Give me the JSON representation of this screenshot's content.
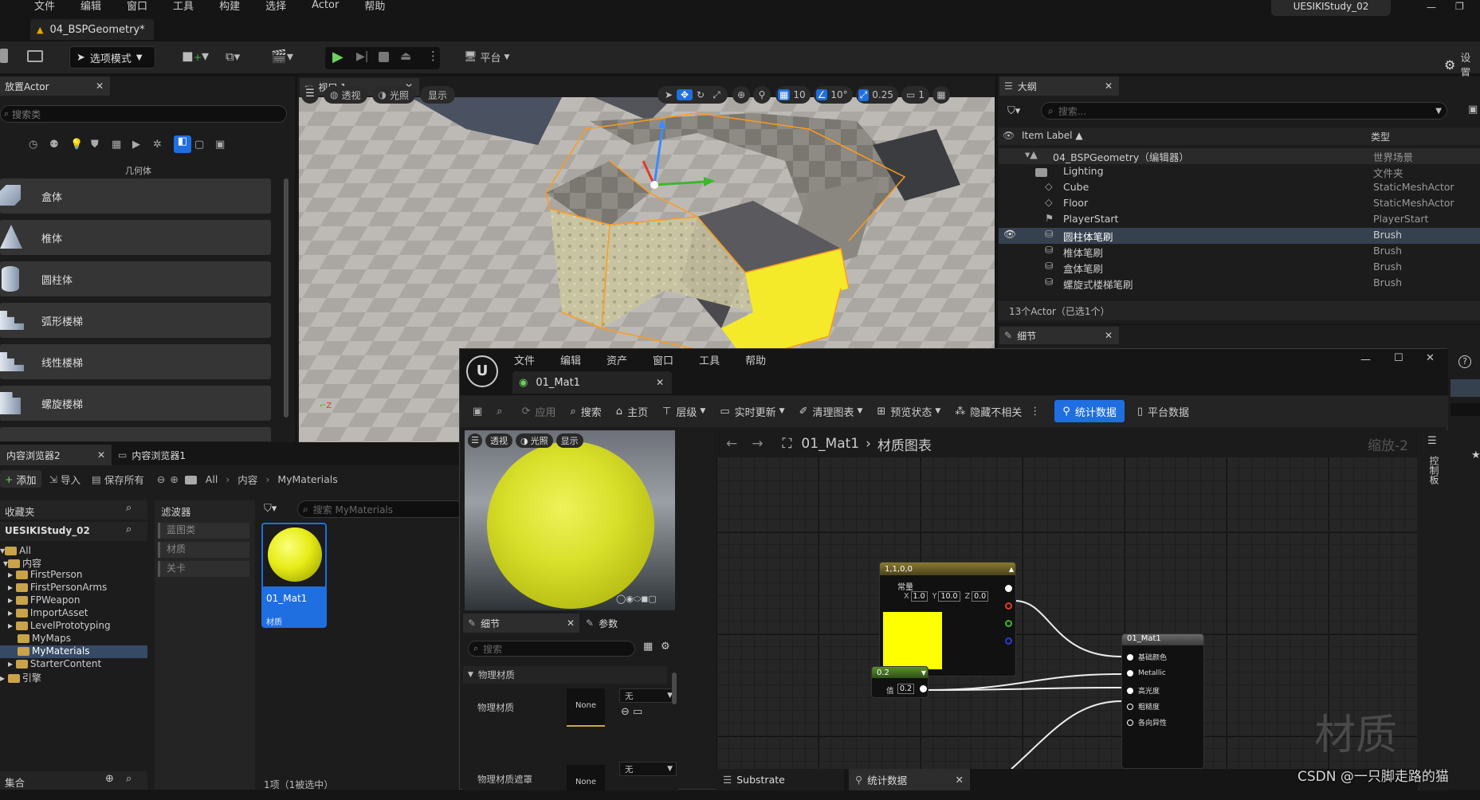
{
  "menu_bar": {
    "items": [
      "文件",
      "编辑",
      "窗口",
      "工具",
      "构建",
      "选择",
      "Actor",
      "帮助"
    ],
    "project_name": "UESIKIStudy_02"
  },
  "level_tab": {
    "label": "04_BSPGeometry*"
  },
  "main_toolbar": {
    "mode_label": "选项模式",
    "platform_label": "平台",
    "settings_label": "设置"
  },
  "place_actors": {
    "tab_label": "放置Actor",
    "search_placeholder": "搜索类",
    "category_label": "几何体",
    "items": [
      "盒体",
      "椎体",
      "圆柱体",
      "弧形楼梯",
      "线性楼梯",
      "螺旋楼梯"
    ]
  },
  "viewport": {
    "tab_label": "视口 1",
    "buttons": [
      "透视",
      "光照",
      "显示"
    ],
    "grid_snap": "10",
    "rotation_snap": "10°",
    "scale_snap": "0.25",
    "camera_speed": "1",
    "highlight_color": "#f4ea2a"
  },
  "outliner": {
    "tab_label": "大纲",
    "search_placeholder": "搜索...",
    "col_label": "Item Label ▲",
    "col_type": "类型",
    "rows": [
      {
        "name": "04_BSPGeometry（编辑器）",
        "type": "世界场景"
      },
      {
        "name": "Lighting",
        "type": "文件夹"
      },
      {
        "name": "Cube",
        "type": "StaticMeshActor"
      },
      {
        "name": "Floor",
        "type": "StaticMeshActor"
      },
      {
        "name": "PlayerStart",
        "type": "PlayerStart"
      },
      {
        "name": "圆柱体笔刷",
        "type": "Brush"
      },
      {
        "name": "椎体笔刷",
        "type": "Brush"
      },
      {
        "name": "盒体笔刷",
        "type": "Brush"
      },
      {
        "name": "螺旋式楼梯笔刷",
        "type": "Brush"
      }
    ],
    "footer": "13个Actor（已选1个）"
  },
  "details_tab": {
    "label": "细节"
  },
  "content_browser": {
    "tab1": "内容浏览器2",
    "tab2": "内容浏览器1",
    "add_label": "添加",
    "import_label": "导入",
    "save_all_label": "保存所有",
    "path": [
      "All",
      "内容",
      "MyMaterials"
    ],
    "favorites_label": "收藏夹",
    "project_label": "UESIKIStudy_02",
    "filters_label": "滤波器",
    "filters": [
      "蓝图类",
      "材质",
      "关卡"
    ],
    "search_placeholder": "搜索 MyMaterials",
    "tree": [
      "All",
      "内容",
      "FirstPerson",
      "FirstPersonArms",
      "FPWeapon",
      "ImportAsset",
      "LevelPrototyping",
      "MyMaps",
      "MyMaterials",
      "StarterContent",
      "引擎"
    ],
    "asset_name": "01_Mat1",
    "asset_type": "材质",
    "collections_label": "集合",
    "status": "1项（1被选中）"
  },
  "material_editor": {
    "menu": [
      "文件",
      "编辑",
      "资产",
      "窗口",
      "工具",
      "帮助"
    ],
    "tab_label": "01_Mat1",
    "toolbar": [
      "应用",
      "搜索",
      "主页",
      "层级",
      "实时更新",
      "清理图表",
      "预览状态",
      "隐藏不相关",
      "统计数据",
      "平台数据"
    ],
    "preview_buttons": [
      "透视",
      "光照",
      "显示"
    ],
    "breadcrumb_asset": "01_Mat1",
    "breadcrumb_graph": "材质图表",
    "zoom": "缩放-2",
    "side_tab": "控制板",
    "watermark": "材质",
    "details_tab": "细节",
    "params_tab": "参数",
    "search_placeholder": "搜索",
    "section_label": "物理材质",
    "prop1_label": "物理材质",
    "prop2_label": "物理材质遮罩",
    "none_label": "None",
    "dropdown_value": "无",
    "bottom_tabs": [
      "Substrate",
      "统计数据"
    ],
    "const_node": {
      "title": "1,1,0,0",
      "label": "常量",
      "x_label": "X",
      "x": "1.0",
      "y_label": "Y",
      "y": "10.0",
      "z_label": "Z",
      "z": "0.0",
      "color": "#ffff00"
    },
    "scalar_node": {
      "title": "0.2",
      "label": "值",
      "value": "0.2"
    },
    "result_node": {
      "title": "01_Mat1",
      "pins": [
        "基础颜色",
        "Metallic",
        "高光度",
        "粗糙度",
        "各向异性"
      ]
    }
  },
  "watermark": "CSDN @一只脚走路的猫"
}
